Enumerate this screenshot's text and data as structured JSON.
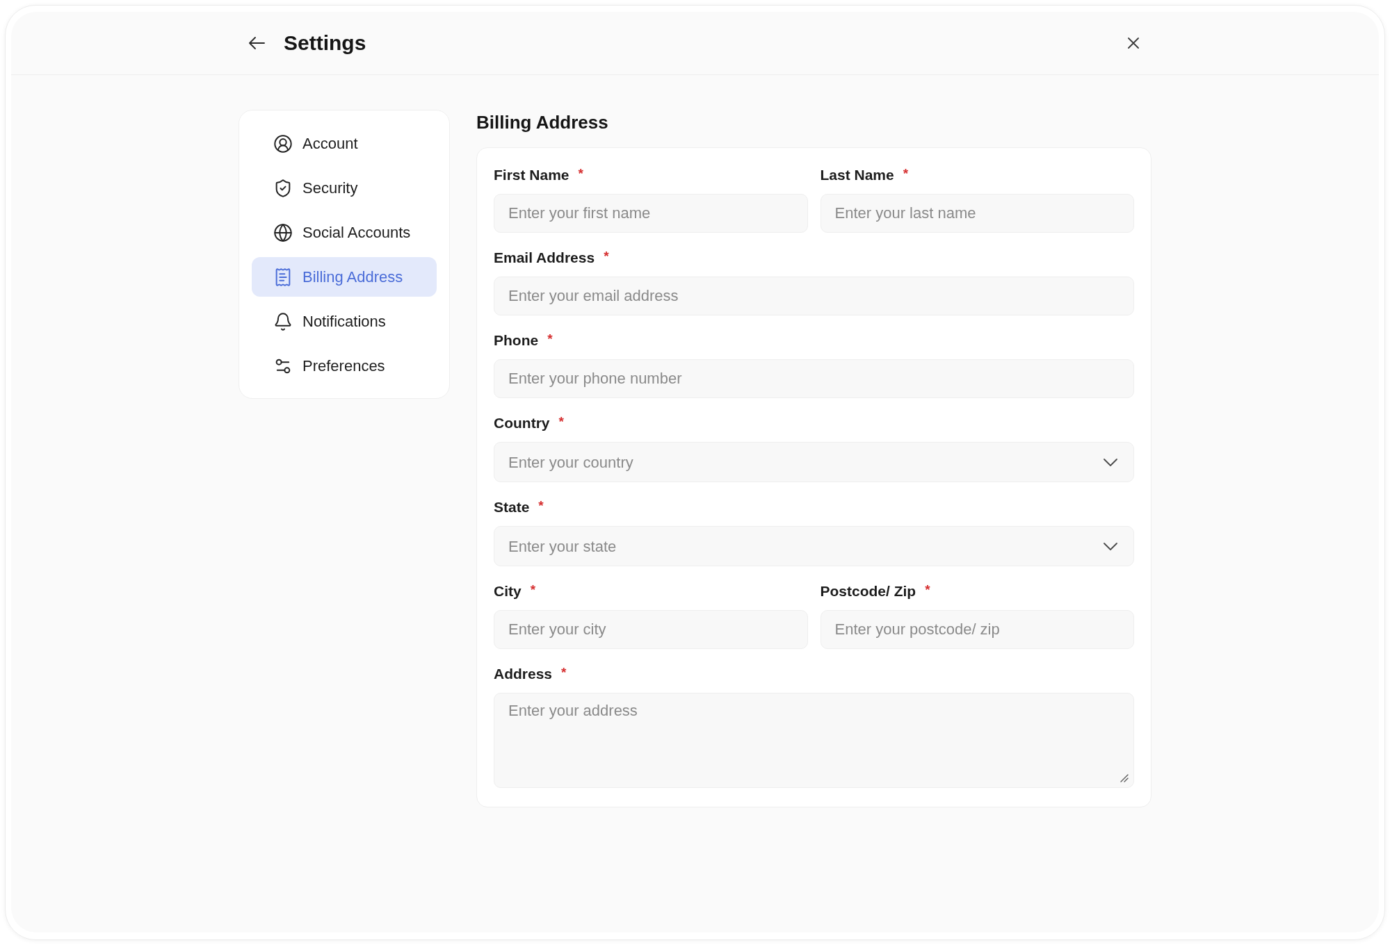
{
  "header": {
    "title": "Settings"
  },
  "sidebar": {
    "items": [
      {
        "label": "Account",
        "selected": false
      },
      {
        "label": "Security",
        "selected": false
      },
      {
        "label": "Social Accounts",
        "selected": false
      },
      {
        "label": "Billing Address",
        "selected": true
      },
      {
        "label": "Notifications",
        "selected": false
      },
      {
        "label": "Preferences",
        "selected": false
      }
    ]
  },
  "form": {
    "title": "Billing Address",
    "rows": [
      {
        "fields": [
          {
            "kind": "text",
            "label": "First Name",
            "required_mark": "*",
            "placeholder": "Enter your first name"
          },
          {
            "kind": "text",
            "label": "Last Name",
            "required_mark": "*",
            "placeholder": "Enter your last name"
          }
        ]
      },
      {
        "fields": [
          {
            "kind": "text",
            "label": "Email Address",
            "required_mark": "*",
            "placeholder": "Enter your email address"
          }
        ]
      },
      {
        "fields": [
          {
            "kind": "text",
            "label": "Phone",
            "required_mark": "*",
            "placeholder": "Enter your phone number"
          }
        ]
      },
      {
        "fields": [
          {
            "kind": "select",
            "label": "Country",
            "required_mark": "*",
            "placeholder": "Enter your country"
          }
        ]
      },
      {
        "fields": [
          {
            "kind": "select",
            "label": "State",
            "required_mark": "*",
            "placeholder": "Enter your state"
          }
        ]
      },
      {
        "fields": [
          {
            "kind": "text",
            "label": "City",
            "required_mark": "*",
            "placeholder": "Enter your city"
          },
          {
            "kind": "text",
            "label": "Postcode/ Zip",
            "required_mark": "*",
            "placeholder": "Enter your postcode/ zip"
          }
        ]
      },
      {
        "fields": [
          {
            "kind": "textarea",
            "label": "Address",
            "required_mark": "*",
            "placeholder": "Enter your address"
          }
        ]
      }
    ]
  }
}
